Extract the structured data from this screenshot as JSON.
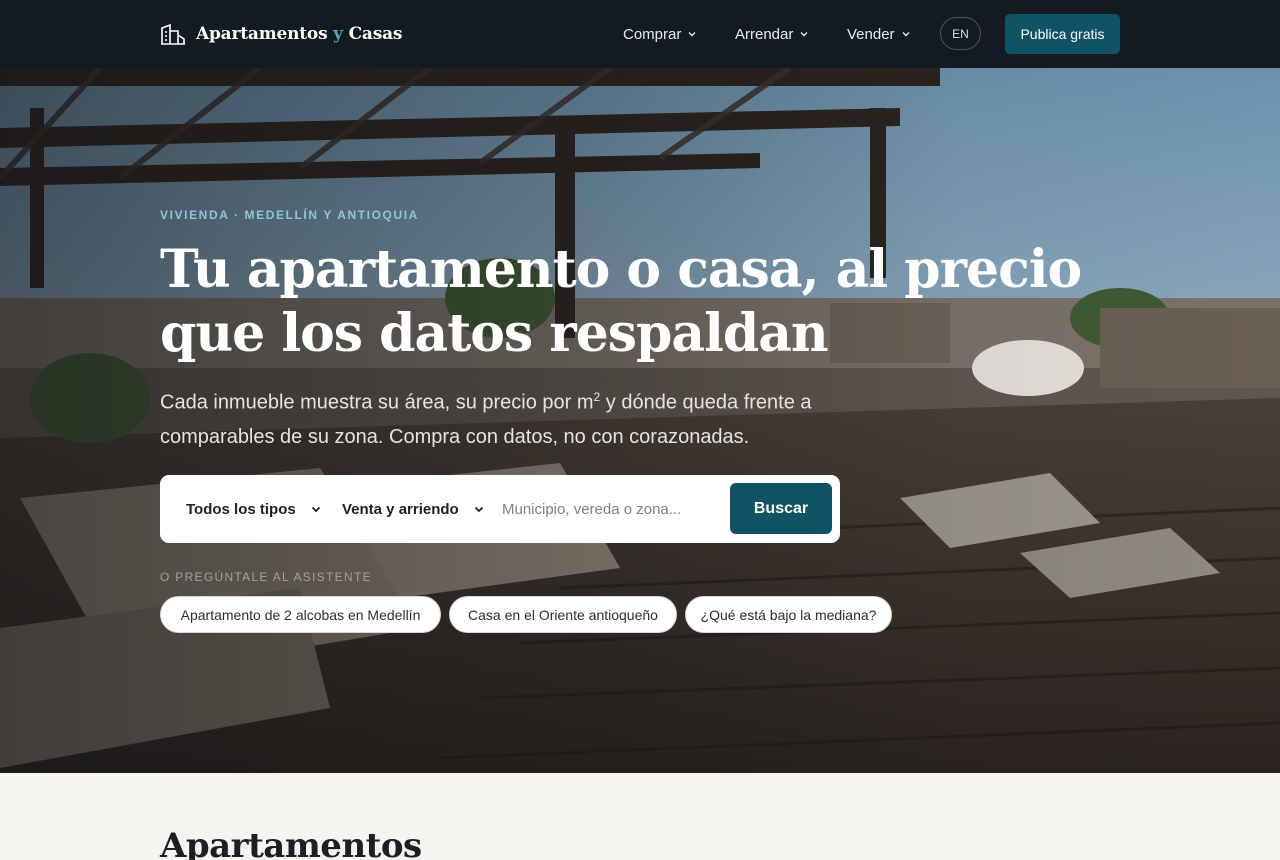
{
  "header": {
    "brand_left": "Apartamentos",
    "brand_join": "y",
    "brand_right": "Casas",
    "nav": [
      {
        "label": "Comprar"
      },
      {
        "label": "Arrendar"
      },
      {
        "label": "Vender"
      }
    ],
    "lang_label": "EN",
    "cta_label": "Publica gratis"
  },
  "hero": {
    "eyebrow": "VIVIENDA · MEDELLÍN Y ANTIOQUIA",
    "headline": "Tu apartamento o casa, al precio que los datos respaldan",
    "subtitle_part1": "Cada inmueble muestra su área, su precio por m",
    "subtitle_sup": "2",
    "subtitle_part2": " y dónde queda frente a comparables de su zona. Compra con datos, no con corazonadas.",
    "search": {
      "type_value": "Todos los tipos",
      "mode_value": "Venta y arriendo",
      "placeholder": "Municipio, vereda o zona...",
      "button_label": "Buscar"
    },
    "assistant_label": "O PREGÚNTALE AL ASISTENTE",
    "suggestions": [
      "Apartamento de 2 alcobas en Medellín",
      "Casa en el Oriente antioqueño",
      "¿Qué está bajo la mediana?"
    ]
  },
  "listings_section": {
    "title": "Apartamentos"
  },
  "colors": {
    "header_bg": "#121b21",
    "accent": "#0f5364",
    "eyebrow": "#8fc6d6",
    "page_bg": "#f5f4f1"
  }
}
